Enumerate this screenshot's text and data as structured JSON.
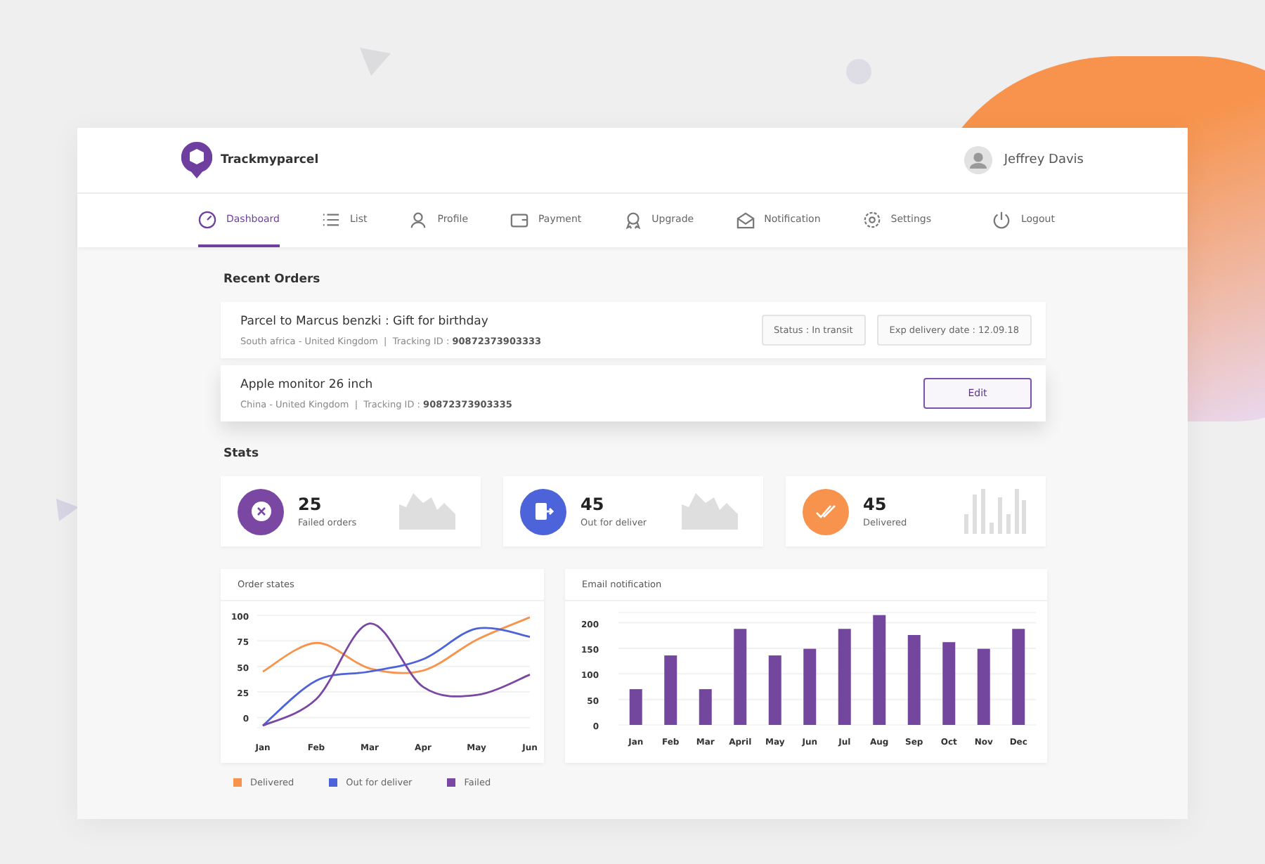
{
  "header": {
    "brand": "Trackmyparcel",
    "user": "Jeffrey Davis"
  },
  "nav": [
    {
      "label": "Dashboard",
      "selected": true
    },
    {
      "label": "List",
      "selected": false
    },
    {
      "label": "Profile",
      "selected": false
    },
    {
      "label": "Payment",
      "selected": false
    },
    {
      "label": "Upgrade",
      "selected": false
    },
    {
      "label": "Notification",
      "selected": false
    },
    {
      "label": "Settings",
      "selected": false
    },
    {
      "label": "Logout",
      "selected": false
    }
  ],
  "recent_orders": {
    "title": "Recent Orders",
    "rows": [
      {
        "title": "Parcel to Marcus benzki : Gift for birthday",
        "meta": "South africa - United Kingdom  |  Tracking ID : **90872373903333**",
        "tags": [
          "Status : In transit",
          "Exp delivery date : 12.09.18"
        ]
      },
      {
        "title": "Apple monitor 26 inch",
        "meta": "China - United Kingdom  |  Tracking ID : **90872373903335**",
        "action": "Edit"
      }
    ]
  },
  "stats": {
    "title": "Stats",
    "cards": [
      {
        "value": "25",
        "label": "Failed orders",
        "color": "#7a48a3",
        "kind": "area"
      },
      {
        "value": "45",
        "label": "Out for deliver",
        "color": "#4c63d9",
        "kind": "area"
      },
      {
        "value": "45",
        "label": "Delivered",
        "color": "#f7934c",
        "kind": "bars"
      }
    ]
  },
  "order_states": {
    "title": "Order states",
    "chart_data": {
      "type": "line",
      "categories": [
        "Jan",
        "Feb",
        "Mar",
        "Apr",
        "May",
        "Jun"
      ],
      "grid": true,
      "ylim": [
        -10,
        100
      ],
      "yticks": [
        0,
        25,
        50,
        75,
        100
      ],
      "series": [
        {
          "name": "Delivered",
          "color": "#f7934c",
          "values": [
            45,
            73,
            48,
            46,
            76,
            98
          ]
        },
        {
          "name": "Out for deliver",
          "color": "#4c63d9",
          "values": [
            -8,
            36,
            45,
            57,
            87,
            79
          ]
        },
        {
          "name": "Failed",
          "color": "#7a48a3",
          "values": [
            -8,
            18,
            92,
            30,
            22,
            42
          ]
        }
      ]
    }
  },
  "email_notification": {
    "title": "Email notification",
    "chart_data": {
      "type": "bar",
      "categories": [
        "Jan",
        "Feb",
        "Mar",
        "April",
        "May",
        "Jun",
        "Jul",
        "Aug",
        "Sep",
        "Oct",
        "Nov",
        "Dec"
      ],
      "grid": true,
      "ylim": [
        0,
        220
      ],
      "yticks": [
        0,
        50,
        100,
        150,
        200
      ],
      "series": [
        {
          "color": "#74479f",
          "values": [
            70,
            136,
            70,
            188,
            136,
            149,
            188,
            215,
            176,
            162,
            149,
            188
          ]
        }
      ]
    }
  }
}
